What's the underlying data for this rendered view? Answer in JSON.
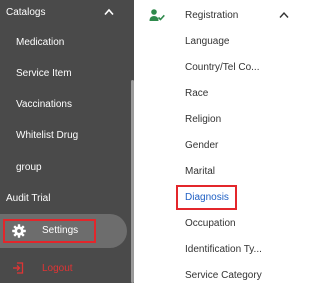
{
  "sidebar": {
    "catalogs_label": "Catalogs",
    "items": [
      "Medication",
      "Service Item",
      "Vaccinations",
      "Whitelist Drug",
      "group"
    ],
    "audit_label": "Audit Trial",
    "settings_label": "Settings",
    "logout_label": "Logout"
  },
  "panel": {
    "section_label": "Registration",
    "items": [
      "Language",
      "Country/Tel Co...",
      "Race",
      "Religion",
      "Gender",
      "Marital",
      "Diagnosis",
      "Occupation",
      "Identification Ty...",
      "Service Category"
    ]
  },
  "colors": {
    "sidebar_bg": "#4a4a4a",
    "highlight_border": "#e3262b",
    "logout_text": "#e03434",
    "active_link": "#1e5fc4",
    "registration_icon": "#2f8a4c"
  }
}
